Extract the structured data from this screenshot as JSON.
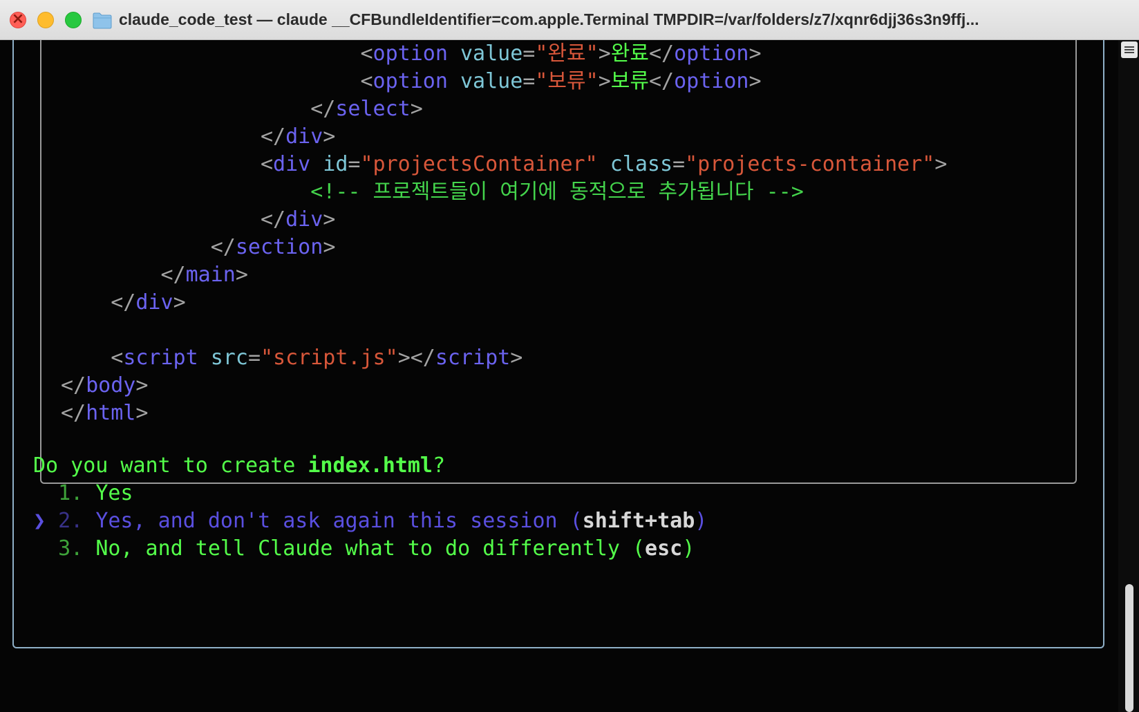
{
  "window": {
    "title": "claude_code_test — claude __CFBundleIdentifier=com.apple.Terminal TMPDIR=/var/folders/z7/xqnr6djj36s3n9ffj..."
  },
  "code_lines": [
    {
      "indent": "                        ",
      "open": "<",
      "tag": "option",
      "sp": " ",
      "attr": "value",
      "eq": "=",
      "str": "\"완료\"",
      "close": ">",
      "text": "완료",
      "end_open": "</",
      "end_tag": "option",
      "end_close": ">"
    },
    {
      "indent": "                        ",
      "open": "<",
      "tag": "option",
      "sp": " ",
      "attr": "value",
      "eq": "=",
      "str": "\"보류\"",
      "close": ">",
      "text": "보류",
      "end_open": "</",
      "end_tag": "option",
      "end_close": ">"
    }
  ],
  "code": {
    "l3_indent": "                    ",
    "l3_open": "</",
    "l3_tag": "select",
    "l3_close": ">",
    "l4_indent": "                ",
    "l4_open": "</",
    "l4_tag": "div",
    "l4_close": ">",
    "l5_indent": "                ",
    "l5_open": "<",
    "l5_tag": "div",
    "l5_attr1": "id",
    "l5_eq": "=",
    "l5_str1": "\"projectsContainer\"",
    "l5_attr2": "class",
    "l5_str2": "\"projects-container\"",
    "l5_close": ">",
    "l6_indent": "                    ",
    "l6_comment": "<!-- 프로젝트들이 여기에 동적으로 추가됩니다 -->",
    "l7_indent": "                ",
    "l7_open": "</",
    "l7_tag": "div",
    "l7_close": ">",
    "l8_indent": "            ",
    "l8_open": "</",
    "l8_tag": "section",
    "l8_close": ">",
    "l9_indent": "        ",
    "l9_open": "</",
    "l9_tag": "main",
    "l9_close": ">",
    "l10_indent": "    ",
    "l10_open": "</",
    "l10_tag": "div",
    "l10_close": ">",
    "l12_indent": "    ",
    "l12_open": "<",
    "l12_tag": "script",
    "l12_attr": "src",
    "l12_eq": "=",
    "l12_str": "\"script.js\"",
    "l12_close": "></",
    "l12_endtag": "script",
    "l12_end": ">",
    "l13_open": "</",
    "l13_tag": "body",
    "l13_close": ">",
    "l14_open": "</",
    "l14_tag": "html",
    "l14_close": ">"
  },
  "prompt": {
    "question_prefix": "Do you want to create ",
    "filename": "index.html",
    "question_suffix": "?"
  },
  "options": [
    {
      "cursor": "  ",
      "number": "1. ",
      "label": "Yes",
      "hint": "",
      "hint_close": ""
    },
    {
      "cursor": "❯ ",
      "number": "2. ",
      "label": "Yes, and don't ask again this session (",
      "hint": "shift+tab",
      "hint_close": ")"
    },
    {
      "cursor": "  ",
      "number": "3. ",
      "label": "No, and tell Claude what to do differently (",
      "hint": "esc",
      "hint_close": ")"
    }
  ]
}
